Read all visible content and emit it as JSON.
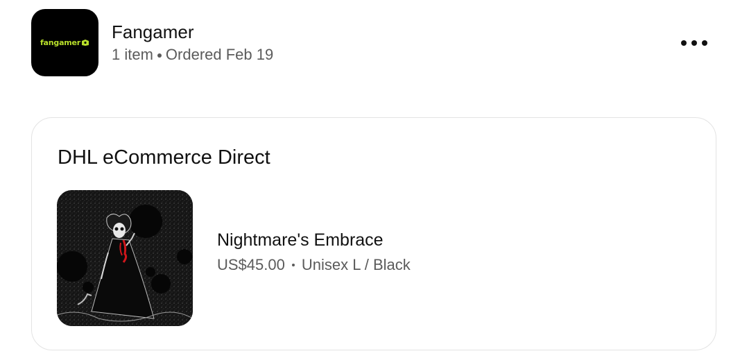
{
  "store": {
    "logo_text": "fangamer",
    "name": "Fangamer",
    "item_count": "1 item",
    "ordered": "Ordered Feb 19",
    "logo_bg_color": "#000000",
    "logo_text_color": "#b9e02b"
  },
  "menu": {
    "icon": "more-horizontal-icon"
  },
  "shipment": {
    "carrier": "DHL eCommerce Direct",
    "items": [
      {
        "name": "Nightmare's Embrace",
        "price": "US$45.00",
        "variant": "Unisex L / Black",
        "image": "nightmares-embrace-artwork"
      }
    ]
  }
}
